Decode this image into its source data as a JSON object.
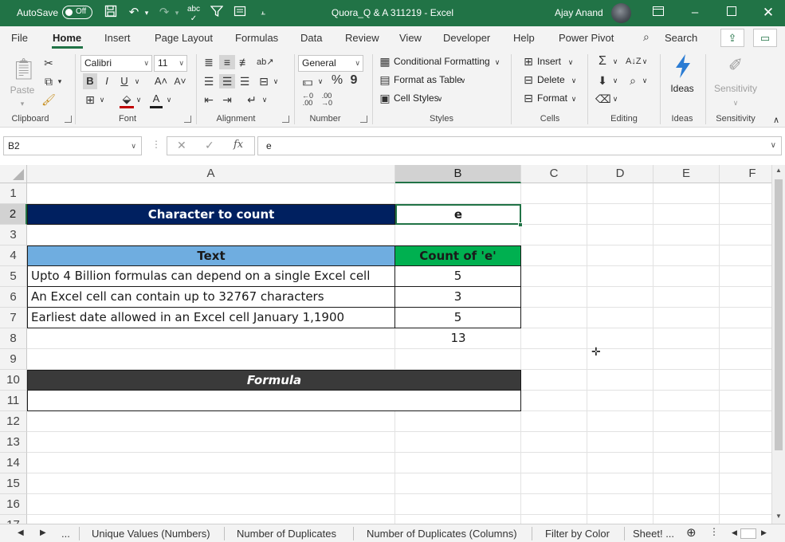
{
  "titlebar": {
    "autosave_label": "AutoSave",
    "autosave_state": "Off",
    "title": "Quora_Q & A 311219  -  Excel",
    "user": "Ajay Anand",
    "icons": [
      "save-icon",
      "undo-icon",
      "redo-icon",
      "spelling-icon",
      "filter-icon",
      "form-icon",
      "customize-qat-icon"
    ]
  },
  "tabs": [
    "File",
    "Home",
    "Insert",
    "Page Layout",
    "Formulas",
    "Data",
    "Review",
    "View",
    "Developer",
    "Help",
    "Power Pivot"
  ],
  "active_tab": "Home",
  "search_label": "Search",
  "ribbon": {
    "clipboard": {
      "paste": "Paste",
      "label": "Clipboard"
    },
    "font": {
      "name": "Calibri",
      "size": "11",
      "bold": "B",
      "italic": "I",
      "underline": "U",
      "grow": "A˄",
      "shrink": "A˅",
      "label": "Font"
    },
    "alignment": {
      "label": "Alignment"
    },
    "number": {
      "format": "General",
      "percent": "%",
      "comma": "9",
      "label": "Number"
    },
    "styles": {
      "conditional": "Conditional Formatting",
      "table": "Format as Table",
      "cell_styles": "Cell Styles",
      "label": "Styles"
    },
    "cells": {
      "insert": "Insert",
      "delete": "Delete",
      "format": "Format",
      "label": "Cells"
    },
    "editing": {
      "label": "Editing"
    },
    "ideas": {
      "button": "Ideas",
      "label": "Ideas"
    },
    "sensitivity": {
      "button": "Sensitivity",
      "label": "Sensitivity"
    }
  },
  "formula_bar": {
    "name_box": "B2",
    "fx": "fx",
    "value": "e"
  },
  "columns": [
    "A",
    "B",
    "C",
    "D",
    "E",
    "F"
  ],
  "rows": [
    "1",
    "2",
    "3",
    "4",
    "5",
    "6",
    "7",
    "8",
    "9",
    "10",
    "11",
    "12",
    "13",
    "14",
    "15",
    "16",
    "17"
  ],
  "cells": {
    "a2": "Character to count",
    "b2": "e",
    "a4": "Text",
    "b4": "Count of 'e'",
    "a5": "Upto 4 Billion formulas can depend on a single Excel cell",
    "b5": "5",
    "a6": "An Excel cell can contain up to 32767 characters",
    "b6": "3",
    "a7": "Earliest date allowed in an Excel cell January 1,1900",
    "b7": "5",
    "b8": "13",
    "a10": "Formula"
  },
  "colors": {
    "excel_green": "#217346",
    "header_navy": "#002060",
    "text_header_blue": "#6fade0",
    "count_header_green": "#00b050",
    "formula_header_dark": "#3a3a3a"
  },
  "sheet_tabs": [
    "Unique Values (Numbers)",
    "Number of Duplicates",
    "Number of Duplicates (Columns)",
    "Filter by Color",
    "Sheet! ..."
  ],
  "sheet_nav": {
    "ellipsis": "..."
  }
}
